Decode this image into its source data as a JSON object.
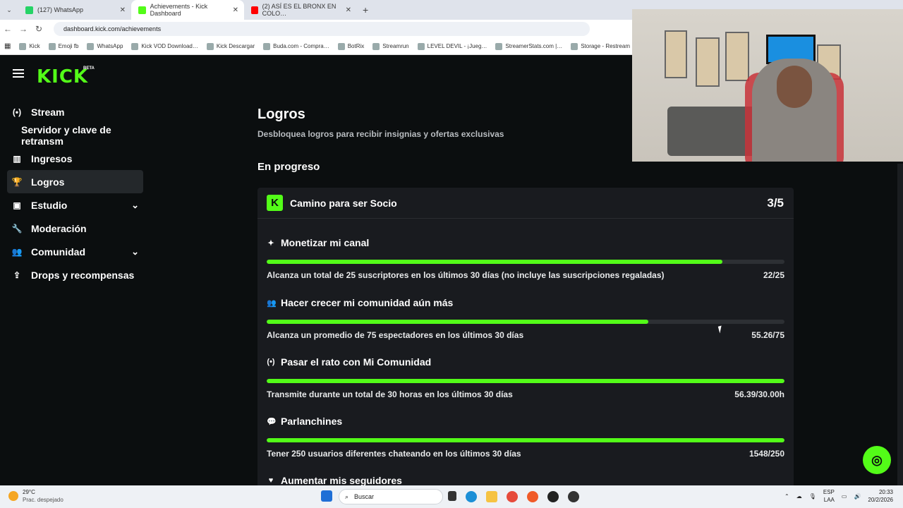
{
  "browser": {
    "tabs": [
      {
        "label": "(127) WhatsApp",
        "color": "#25d366"
      },
      {
        "label": "Achievements - Kick Dashboard",
        "color": "#53fc18"
      },
      {
        "label": "(2) ASÍ ES EL BRONX EN COLO…",
        "color": "#ff0000"
      }
    ],
    "url": "dashboard.kick.com/achievements",
    "bookmarks": [
      "Kick",
      "Emoji fb",
      "WhatsApp",
      "Kick VOD Download…",
      "Kick Descargar",
      "Buda.com - Compra…",
      "BotRix",
      "Streamrun",
      "LEVEL DEVIL - ¡Jueg…",
      "StreamerStats.com |…",
      "Storage - Restream"
    ]
  },
  "brand": {
    "logo": "KICK",
    "beta": "BETA",
    "accent": "#53fc18"
  },
  "sidebar": {
    "items": [
      {
        "label": "Stream",
        "icon": "broadcast-icon",
        "glyph": "(•)"
      },
      {
        "label": "Servidor y clave de retransm",
        "sub": true
      },
      {
        "label": "Ingresos",
        "icon": "chart-icon",
        "glyph": "▥"
      },
      {
        "label": "Logros",
        "icon": "trophy-icon",
        "glyph": "🏆",
        "active": true
      },
      {
        "label": "Estudio",
        "icon": "studio-icon",
        "glyph": "▣",
        "chevron": true
      },
      {
        "label": "Moderación",
        "icon": "wrench-icon",
        "glyph": "🔧"
      },
      {
        "label": "Comunidad",
        "icon": "community-icon",
        "glyph": "👥",
        "chevron": true
      },
      {
        "label": "Drops y recompensas",
        "icon": "drops-icon",
        "glyph": "⇪"
      }
    ]
  },
  "page": {
    "title": "Logros",
    "subtitle": "Desbloquea logros para recibir insignias y ofertas exclusivas",
    "section": "En progreso"
  },
  "card": {
    "title": "Camino para ser Socio",
    "count": "3/5",
    "goals": [
      {
        "title": "Monetizar mi canal",
        "icon": "sparkle-icon",
        "glyph": "✦",
        "desc": "Alcanza un total de 25 suscriptores en los últimos 30 días (no incluye las suscripciones regaladas)",
        "value": "22/25",
        "progress": 0.88
      },
      {
        "title": "Hacer crecer mi comunidad aún más",
        "icon": "users-icon",
        "glyph": "👥",
        "desc": "Alcanza un promedio de 75 espectadores en los últimos 30 días",
        "value": "55.26/75",
        "progress": 0.737
      },
      {
        "title": "Pasar el rato con Mi Comunidad",
        "icon": "broadcast-icon",
        "glyph": "(•)",
        "desc": "Transmite durante un total de 30 horas en los últimos 30 días",
        "value": "56.39/30.00h",
        "progress": 1
      },
      {
        "title": "Parlanchines",
        "icon": "chat-icon",
        "glyph": "💬",
        "desc": "Tener 250 usuarios diferentes chateando en los últimos 30 días",
        "value": "1548/250",
        "progress": 1
      },
      {
        "title": "Aumentar mis seguidores",
        "icon": "heart-icon",
        "glyph": "♥"
      }
    ]
  },
  "taskbar": {
    "temp": "29°C",
    "weather": "Prac. despejado",
    "search": "Buscar",
    "lang": "ESP",
    "lang2": "LAA",
    "time": "20:33",
    "date": "20/2/2026"
  }
}
